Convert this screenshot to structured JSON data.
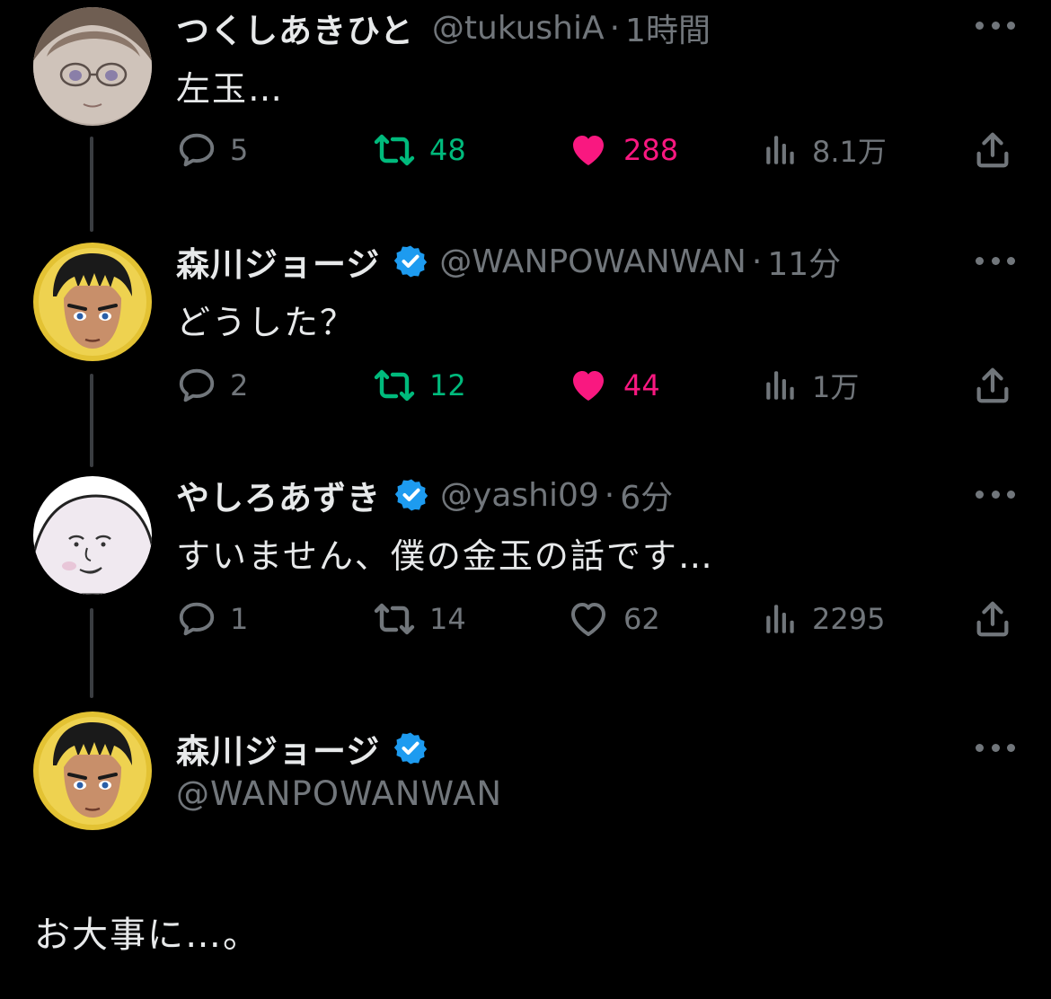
{
  "tweets": [
    {
      "name": "つくしあきひと",
      "verified": false,
      "handle": "@tukushiA",
      "time": "1時間",
      "text": "左玉…",
      "replies": "5",
      "retweets": "48",
      "likes": "288",
      "views": "8.1万",
      "retweeted": true,
      "liked": true
    },
    {
      "name": "森川ジョージ",
      "verified": true,
      "handle": "@WANPOWANWAN",
      "time": "11分",
      "text": "どうした？",
      "replies": "2",
      "retweets": "12",
      "likes": "44",
      "views": "1万",
      "retweeted": true,
      "liked": true
    },
    {
      "name": "やしろあずき",
      "verified": true,
      "handle": "@yashi09",
      "time": "6分",
      "text": "すいません、僕の金玉の話です…",
      "replies": "1",
      "retweets": "14",
      "likes": "62",
      "views": "2295",
      "retweeted": false,
      "liked": false
    }
  ],
  "main_tweet": {
    "name": "森川ジョージ",
    "verified": true,
    "handle": "@WANPOWANWAN",
    "text": "お大事に…。"
  },
  "colors": {
    "background": "#000000",
    "secondary_text": "#71767b",
    "retweet_green": "#00ba7c",
    "like_pink": "#f91880",
    "verified_blue": "#1d9bf0"
  },
  "separator": "·"
}
